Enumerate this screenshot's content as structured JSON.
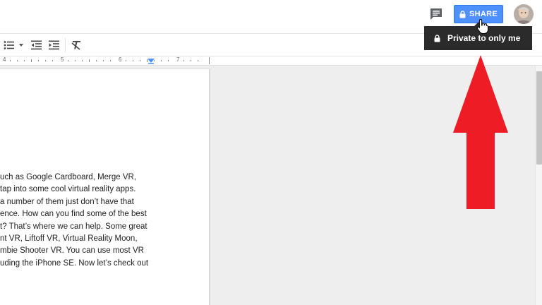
{
  "header": {
    "share_label": "SHARE",
    "icons": {
      "comments": "comment-icon",
      "share_lock": "lock-icon",
      "avatar": "user-avatar"
    }
  },
  "tooltip": {
    "text": "Private to only me",
    "icon": "lock-icon"
  },
  "toolbar": {
    "icons": [
      "bulleted-list-icon",
      "dropdown-caret-icon",
      "decrease-indent-icon",
      "increase-indent-icon",
      "clear-formatting-icon"
    ]
  },
  "ruler": {
    "numbers": [
      "4",
      "5",
      "6",
      "7"
    ]
  },
  "document": {
    "lines": [
      "uch as Google Cardboard, Merge VR,",
      "tap into some cool virtual reality apps.",
      "a number of them just don’t have that",
      "ence. How can you find some of the best",
      "t? That’s where we can help. Some great",
      "nt VR, Liftoff VR, Virtual Reality Moon,",
      "mbie Shooter VR. You can use most VR",
      "uding the iPhone SE. Now let’s check out"
    ]
  },
  "colors": {
    "share_button": "#4d90fe",
    "tooltip_bg": "#2b2b2b",
    "annotation_arrow": "#ee1c25",
    "canvas_bg": "#eeeeee"
  }
}
